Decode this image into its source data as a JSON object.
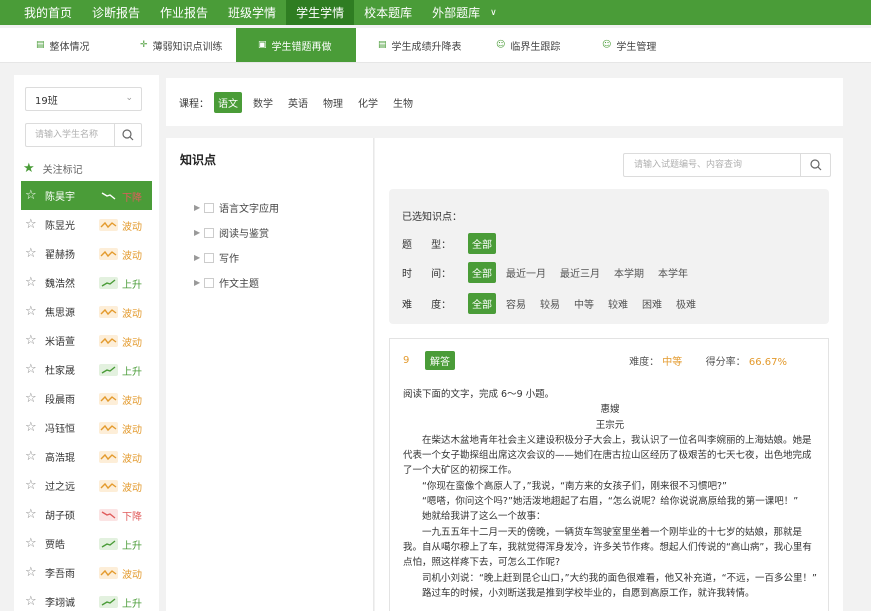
{
  "topnav": {
    "items": [
      {
        "label": "我的首页",
        "active": false
      },
      {
        "label": "诊断报告",
        "active": false
      },
      {
        "label": "作业报告",
        "active": false
      },
      {
        "label": "班级学情",
        "active": false
      },
      {
        "label": "学生学情",
        "active": true
      },
      {
        "label": "校本题库",
        "active": false
      },
      {
        "label": "外部题库",
        "active": false,
        "dropdown": true
      }
    ]
  },
  "subnav": {
    "items": [
      {
        "label": "整体情况",
        "icon": "report-icon"
      },
      {
        "label": "薄弱知识点训练",
        "icon": "target-icon"
      },
      {
        "label": "学生错题再做",
        "icon": "redo-icon",
        "active": true
      },
      {
        "label": "学生成绩升降表",
        "icon": "table-icon"
      },
      {
        "label": "临界生跟踪",
        "icon": "user-track-icon"
      },
      {
        "label": "学生管理",
        "icon": "user-gear-icon"
      }
    ]
  },
  "sidebar": {
    "class_value": "19班",
    "search_placeholder": "请输入学生名称",
    "mark_label": "关注标记",
    "students": [
      {
        "name": "陈昊宇",
        "trend": "下降",
        "kind": "down",
        "active": true
      },
      {
        "name": "陈昱光",
        "trend": "波动",
        "kind": "wave"
      },
      {
        "name": "翟赫扬",
        "trend": "波动",
        "kind": "wave"
      },
      {
        "name": "魏浩然",
        "trend": "上升",
        "kind": "up"
      },
      {
        "name": "焦思源",
        "trend": "波动",
        "kind": "wave"
      },
      {
        "name": "米语萱",
        "trend": "波动",
        "kind": "wave"
      },
      {
        "name": "杜家晟",
        "trend": "上升",
        "kind": "up"
      },
      {
        "name": "段晨雨",
        "trend": "波动",
        "kind": "wave"
      },
      {
        "name": "冯钰恒",
        "trend": "波动",
        "kind": "wave"
      },
      {
        "name": "高浩琨",
        "trend": "波动",
        "kind": "wave"
      },
      {
        "name": "过之远",
        "trend": "波动",
        "kind": "wave"
      },
      {
        "name": "胡子硕",
        "trend": "下降",
        "kind": "down"
      },
      {
        "name": "贾皓",
        "trend": "上升",
        "kind": "up"
      },
      {
        "name": "李吾雨",
        "trend": "波动",
        "kind": "wave"
      },
      {
        "name": "李翊诚",
        "trend": "上升",
        "kind": "up"
      }
    ]
  },
  "course": {
    "label": "课程：",
    "subjects": [
      {
        "label": "语文",
        "active": true
      },
      {
        "label": "数学"
      },
      {
        "label": "英语"
      },
      {
        "label": "物理"
      },
      {
        "label": "化学"
      },
      {
        "label": "生物"
      }
    ]
  },
  "knowledge": {
    "title": "知识点",
    "nodes": [
      "语言文字应用",
      "阅读与鉴赏",
      "写作",
      "作文主题"
    ]
  },
  "main": {
    "search_placeholder": "请输入试题编号、内容查询",
    "selected_label": "已选知识点：",
    "filter_rows": [
      {
        "key": "题      型：",
        "options": [
          "全部"
        ]
      },
      {
        "key": "时      间：",
        "options": [
          "全部",
          "最近一月",
          "最近三月",
          "本学期",
          "本学年"
        ]
      },
      {
        "key": "难      度：",
        "options": [
          "全部",
          "容易",
          "较易",
          "中等",
          "较难",
          "困难",
          "极难"
        ]
      }
    ]
  },
  "question": {
    "number": "9",
    "answer_label": "解答",
    "difficulty_label": "难度：",
    "difficulty_value": "中等",
    "score_label": "得分率：",
    "score_value": "66.67%",
    "intro": "阅读下面的文字，完成 6～9 小题。",
    "article_title": "惠嫂",
    "author": "王宗元",
    "paragraphs": [
      "在柴达木盆地青年社会主义建设积极分子大会上，我认识了一位名叫李婉丽的上海姑娘。她是代表一个女子勘探组出席这次会议的——她们在唐古拉山区经历了极艰苦的七天七夜，出色地完成了一个大矿区的初探工作。",
      "“你现在蛮像个高原人了，”我说，“南方来的女孩子们，刚来很不习惯吧?”",
      "“嗯嗒，你问这个吗?”她活泼地趐起了右眉，“怎么说呢？给你说说高原给我的第一课吧！”",
      "她就给我讲了这么一个故事：",
      "一九五五年十二月一天的傍晚，一辆货车驾驶室里坐着一个刚毕业的十七岁的姑娘，那就是我。自从噶尔穆上了车，我就觉得浑身发冷，许多关节作疼。想起人们传说的“高山病”，我心里有点怕，照这样疼下去，可怎么工作呢?",
      "司机小刘说：“晚上赶到昆仑山口，”大约我的面色很难看，他又补充道，“不远，一百多公里！”",
      "路过车的时候，小刘断送我是推到学校毕业的，自愿到高原工作，就许我转情。"
    ]
  },
  "colors": {
    "primary": "#4a9c38",
    "primary_dark": "#2f7d22",
    "orange": "#e39a2d",
    "up": "#4a9c38",
    "down": "#e05c5c"
  }
}
